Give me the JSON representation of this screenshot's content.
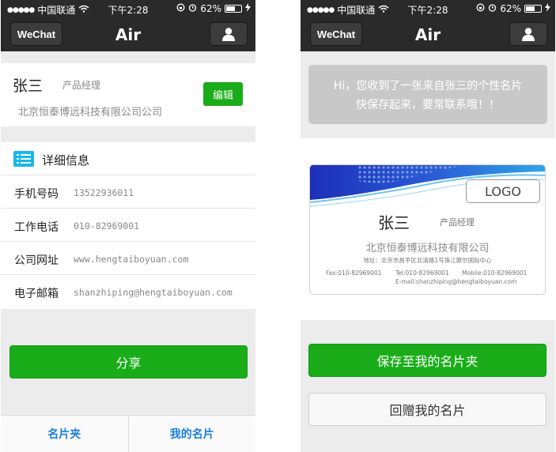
{
  "status_bar": {
    "carrier": "中国联通",
    "time": "下午2:28",
    "battery": "62%",
    "battery_level": 0.62
  },
  "nav": {
    "back_label": "WeChat",
    "title": "Air",
    "profile_icon": "person-icon"
  },
  "profile": {
    "name": "张三",
    "title": "产品经理",
    "company": "北京恒泰博远科技有限公司公司",
    "edit_label": "编辑"
  },
  "details": {
    "header": "详细信息",
    "icon": "list-icon",
    "rows": [
      {
        "label": "手机号码",
        "value": "13522936011"
      },
      {
        "label": "工作电话",
        "value": "010-82969001"
      },
      {
        "label": "公司网址",
        "value": "www.hengtaiboyuan.com"
      },
      {
        "label": "电子邮箱",
        "value": "shanzhiping@hengtaiboyuan.com"
      }
    ]
  },
  "share_label": "分享",
  "tabs": [
    {
      "label": "名片夹"
    },
    {
      "label": "我的名片"
    }
  ],
  "right": {
    "notice_line1": "Hi，您收到了一张来自张三的个性名片",
    "notice_line2": "快保存起来，要常联系哦！！",
    "card": {
      "logo": "LOGO",
      "name": "张三",
      "title": "产品经理",
      "company": "北京恒泰博远科技有限公司",
      "address": "地址：北京市昌平区北清路1号珠江摩尔国际中心",
      "fax": "Fax:010-82969001",
      "tel": "Tel:010-82969001",
      "mobile": "Mobile:010-82969001",
      "email": "E-mail:shanzhiping@hengtaiboyuan.com"
    },
    "save_label": "保存至我的名片夹",
    "gift_label": "回赠我的名片"
  },
  "colors": {
    "accent_green": "#1aad19",
    "nav_dark": "#2a2a2a",
    "link_blue": "#1a7fe0",
    "icon_cyan": "#19b8e8"
  }
}
